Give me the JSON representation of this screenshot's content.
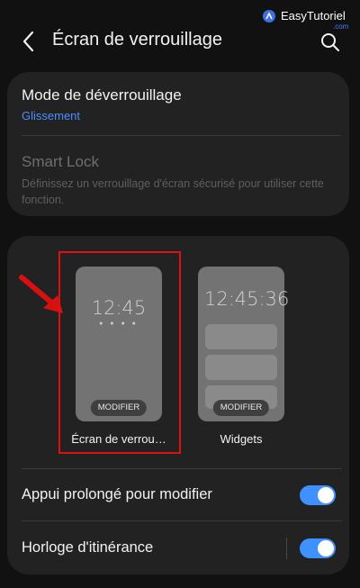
{
  "header": {
    "title": "Écran de verrouillage"
  },
  "watermark": {
    "brand": "EasyTutoriel",
    "domain": ".com"
  },
  "unlock_section": {
    "mode_label": "Mode de déverrouillage",
    "mode_value": "Glissement",
    "smart_lock_label": "Smart Lock",
    "smart_lock_desc": "Définissez un verrouillage d'écran sécurisé pour utiliser cette fonction."
  },
  "preview_section": {
    "lockscreen": {
      "clock": "12:45",
      "edit_label": "MODIFIER",
      "caption": "Écran de verrou…"
    },
    "widgets": {
      "clock": "12:45:36",
      "edit_label": "MODIFIER",
      "caption": "Widgets"
    }
  },
  "settings": {
    "long_press": {
      "label": "Appui prolongé pour modifier",
      "enabled": true
    },
    "roaming_clock": {
      "label": "Horloge d'itinérance",
      "enabled": true
    }
  },
  "colors": {
    "accent": "#3e91ff",
    "link": "#4c8dff",
    "highlight": "#e01010",
    "background": "#111111",
    "card": "#222222"
  }
}
